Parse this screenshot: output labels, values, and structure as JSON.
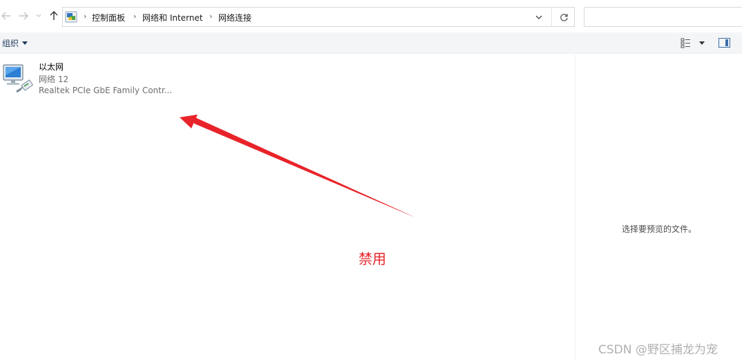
{
  "address": {
    "crumbs": [
      "控制面板",
      "网络和 Internet",
      "网络连接"
    ],
    "separator": "›",
    "search_placeholder": ""
  },
  "command_bar": {
    "organize_label": "组织"
  },
  "connections": [
    {
      "name": "以太网",
      "network": "网络 12",
      "device": "Realtek PCIe GbE Family Contr..."
    }
  ],
  "preview_pane": {
    "message": "选择要预览的文件。"
  },
  "annotation": {
    "label": "禁用",
    "color": "#e8242a"
  },
  "watermark": "CSDN @野区捕龙为宠",
  "icons": {
    "back": "arrow-left-icon",
    "forward": "arrow-right-icon",
    "recent": "chevron-down-icon",
    "up": "arrow-up-icon",
    "location": "network-folder-icon",
    "dropdown": "chevron-down-icon",
    "refresh": "refresh-icon",
    "view": "change-view-icon",
    "preview": "preview-pane-icon",
    "connection": "ethernet-adapter-icon"
  }
}
